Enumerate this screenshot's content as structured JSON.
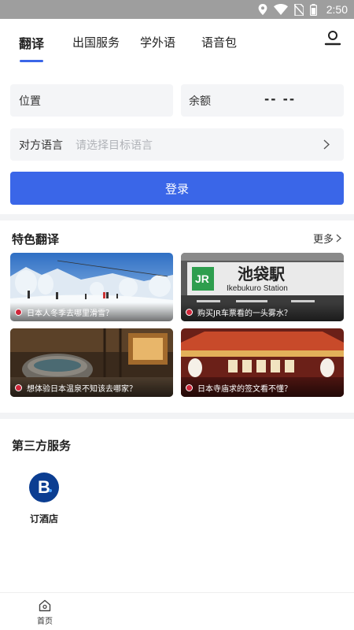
{
  "status_bar": {
    "time": "2:50",
    "icons": [
      "location-icon",
      "wifi-icon",
      "no-sim-icon",
      "battery-icon"
    ]
  },
  "tabs": [
    {
      "label": "翻译",
      "active": true
    },
    {
      "label": "出国服务",
      "active": false
    },
    {
      "label": "学外语",
      "active": false
    },
    {
      "label": "语音包",
      "active": false
    }
  ],
  "form": {
    "location_label": "位置",
    "balance_label": "余额",
    "balance_value": "-- --",
    "language_label": "对方语言",
    "language_placeholder": "请选择目标语言",
    "login_label": "登录"
  },
  "featured": {
    "title": "特色翻译",
    "more_label": "更多",
    "cards": [
      {
        "caption": "日本人冬季去哪里滑雪？",
        "scene": "ski-slope"
      },
      {
        "caption": "购买JR车票看的一头雾水？",
        "scene": "jr-station"
      },
      {
        "caption": "想体验日本温泉不知该去哪家？",
        "scene": "onsen"
      },
      {
        "caption": "日本寺庙求的签文看不懂？",
        "scene": "temple"
      }
    ],
    "sign_text": {
      "jr": "JR",
      "station_name": "池袋駅",
      "station_romaji": "Ikebukuro Station"
    }
  },
  "third_party": {
    "title": "第三方服务",
    "items": [
      {
        "label": "订酒店",
        "logo": "B"
      }
    ]
  },
  "bottom_nav": {
    "home_label": "首页"
  },
  "colors": {
    "accent": "#3a66e8",
    "status_bar": "#9e9e9e",
    "field_bg": "#f4f5f7",
    "booking_blue": "#0b3d91"
  }
}
